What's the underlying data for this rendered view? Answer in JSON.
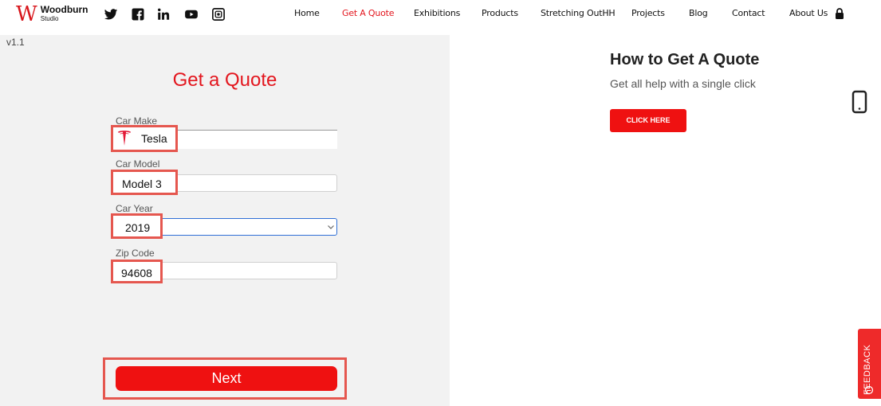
{
  "brand": {
    "logo_letter": "W",
    "name": "Woodburn",
    "sub": "Studio"
  },
  "social_icons": [
    "twitter-icon",
    "facebook-icon",
    "linkedin-icon",
    "youtube-icon",
    "instagram-icon"
  ],
  "nav": {
    "items": [
      "Home",
      "Get A Quote",
      "Exhibitions",
      "Products",
      "Stretching OutHH",
      "Projects",
      "Blog",
      "Contact",
      "About Us"
    ],
    "active": "Get A Quote"
  },
  "version": "v1.1",
  "form": {
    "title": "Get a Quote",
    "car_make": {
      "label": "Car Make",
      "value": "Tesla"
    },
    "car_model": {
      "label": "Car Model",
      "value": "Model 3"
    },
    "car_year": {
      "label": "Car Year",
      "value": "2019"
    },
    "zip_code": {
      "label": "Zip Code",
      "value": "94608"
    },
    "next_label": "Next"
  },
  "help": {
    "title": "How to Get A Quote",
    "subtitle": "Get all help with a single click",
    "button": "CLICK HERE"
  },
  "feedback_label": "FEEDBACK",
  "colors": {
    "accent": "#e3161e",
    "highlight": "#e5574f",
    "panel": "#f2f2f2"
  }
}
